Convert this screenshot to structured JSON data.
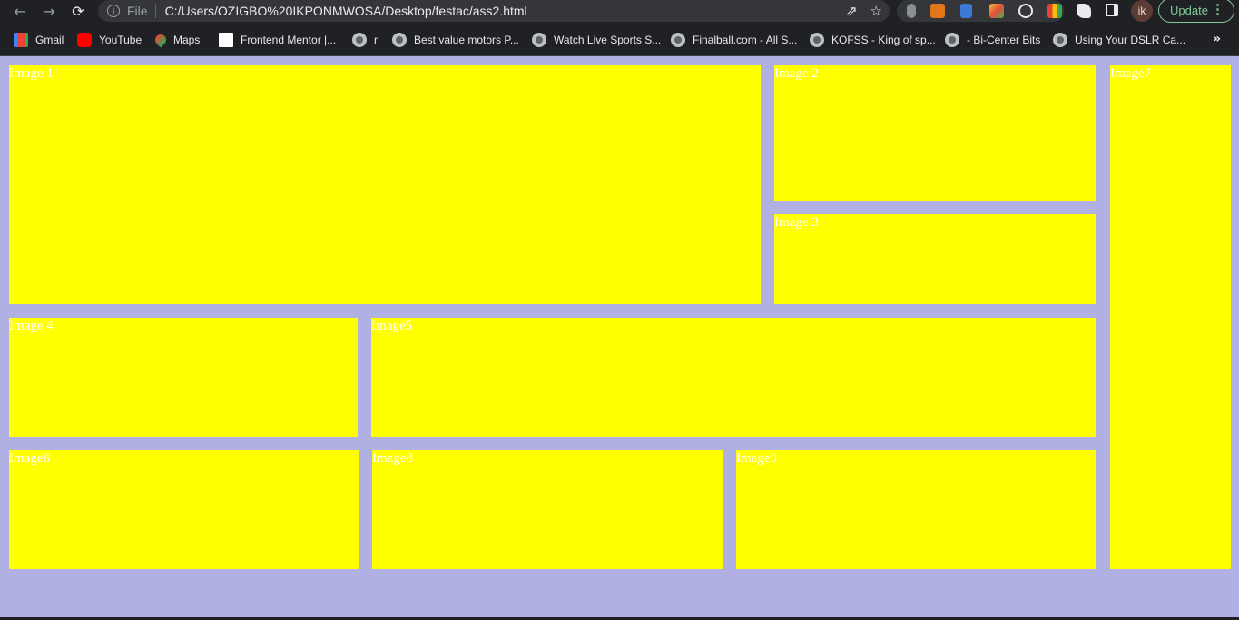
{
  "browser": {
    "omnibox": {
      "scheme_label": "File",
      "url": "C:/Users/OZIGBO%20IKPONMWOSA/Desktop/festac/ass2.html"
    },
    "profile_initials": "ik",
    "update_label": "Update"
  },
  "bookmarks": [
    {
      "label": "Gmail",
      "icon": "gmail-icon"
    },
    {
      "label": "YouTube",
      "icon": "youtube-icon"
    },
    {
      "label": "Maps",
      "icon": "maps-icon"
    },
    {
      "label": "Frontend Mentor |...",
      "icon": "frontend-mentor-icon"
    },
    {
      "label": "r",
      "icon": "globe-icon"
    },
    {
      "label": "Best value motors P...",
      "icon": "globe-icon"
    },
    {
      "label": "Watch Live Sports S...",
      "icon": "globe-icon"
    },
    {
      "label": "Finalball.com - All S...",
      "icon": "globe-icon"
    },
    {
      "label": "KOFSS - King of sp...",
      "icon": "globe-icon"
    },
    {
      "label": "- Bi-Center Bits",
      "icon": "globe-icon"
    },
    {
      "label": "Using Your DSLR Ca...",
      "icon": "globe-icon"
    }
  ],
  "page": {
    "background": "#b0b0e2",
    "tile_color": "#ffff00",
    "tiles": [
      {
        "label": "Image 1"
      },
      {
        "label": "Image 2"
      },
      {
        "label": "Image 3"
      },
      {
        "label": "Image 4"
      },
      {
        "label": "Image5"
      },
      {
        "label": "Image6"
      },
      {
        "label": "Image7"
      },
      {
        "label": "Image8"
      },
      {
        "label": "Image9"
      }
    ]
  }
}
